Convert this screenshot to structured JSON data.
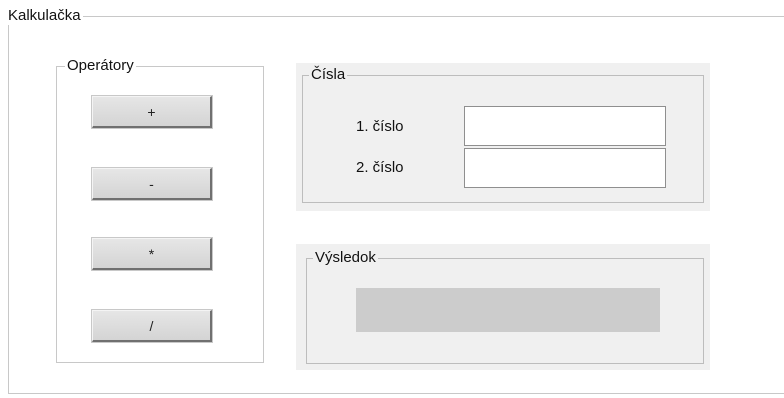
{
  "calculator": {
    "title": "Kalkulačka"
  },
  "operators": {
    "title": "Operátory",
    "buttons": [
      "+",
      "-",
      "*",
      "/"
    ]
  },
  "numbers": {
    "title": "Čísla",
    "first_label": "1. číslo",
    "second_label": "2. číslo",
    "first_value": "",
    "second_value": ""
  },
  "result": {
    "title": "Výsledok",
    "value": ""
  },
  "colors": {
    "window_background": "#ffffff",
    "panel_background": "#f0f0f0",
    "button_face": "#dcdcdc",
    "result_background": "#cccccc",
    "border": "#c8c8c8"
  }
}
